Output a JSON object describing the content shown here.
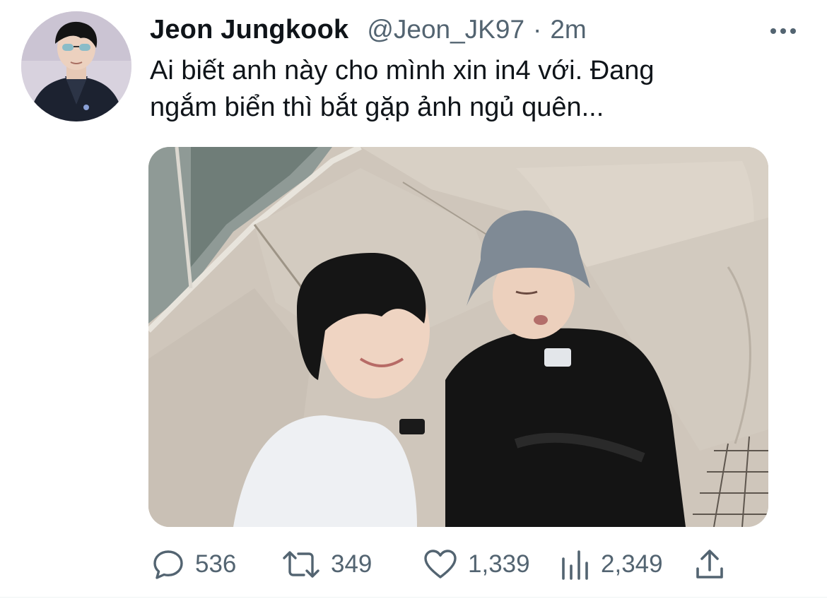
{
  "tweet": {
    "author_name": "Jeon Jungkook",
    "handle": "@Jeon_JK97",
    "separator": "·",
    "time": "2m",
    "text_line1": "Ai biết anh này cho mình xin in4 với. Đang",
    "text_line2": "ngắm biển thì bắt gặp ảnh ngủ quên..."
  },
  "actions": {
    "replies": "536",
    "retweets": "349",
    "likes": "1,339",
    "views": "2,349"
  },
  "icons": {
    "more": "more-horizontal-icon",
    "reply": "reply-icon",
    "retweet": "retweet-icon",
    "like": "heart-icon",
    "views": "analytics-icon",
    "share": "share-icon"
  },
  "colors": {
    "text": "#0f1419",
    "muted": "#536471"
  }
}
